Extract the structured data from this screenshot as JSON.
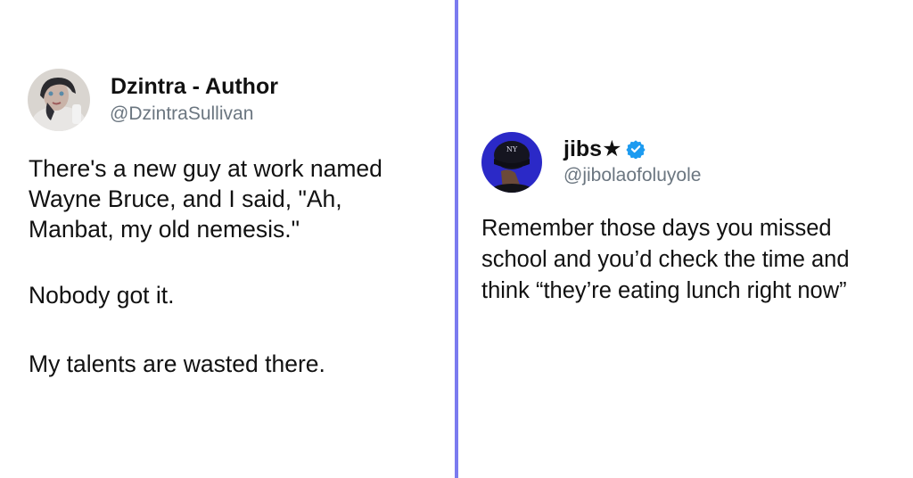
{
  "tweets": [
    {
      "author": "Dzintra - Author",
      "handle": "@DzintraSullivan",
      "paragraphs": [
        "There's a new guy at work named\nWayne Bruce, and I said, \"Ah,\nManbat, my old nemesis.\"",
        "Nobody got it.",
        "My talents are wasted there."
      ]
    },
    {
      "author": "jibs",
      "author_suffix": "★",
      "verified": true,
      "handle": "@jibolaofoluyole",
      "paragraphs": [
        "Remember those days you missed\nschool and you’d check the time and\nthink “they’re eating lunch right now”"
      ]
    }
  ],
  "colors": {
    "divider": "#7b7bef",
    "handle": "#6b7680",
    "verified_badge": "#1d9bf0"
  },
  "icons": {
    "avatar_left": "profile-photo",
    "avatar_right": "profile-photo-cap",
    "verified": "verified-badge-icon"
  }
}
